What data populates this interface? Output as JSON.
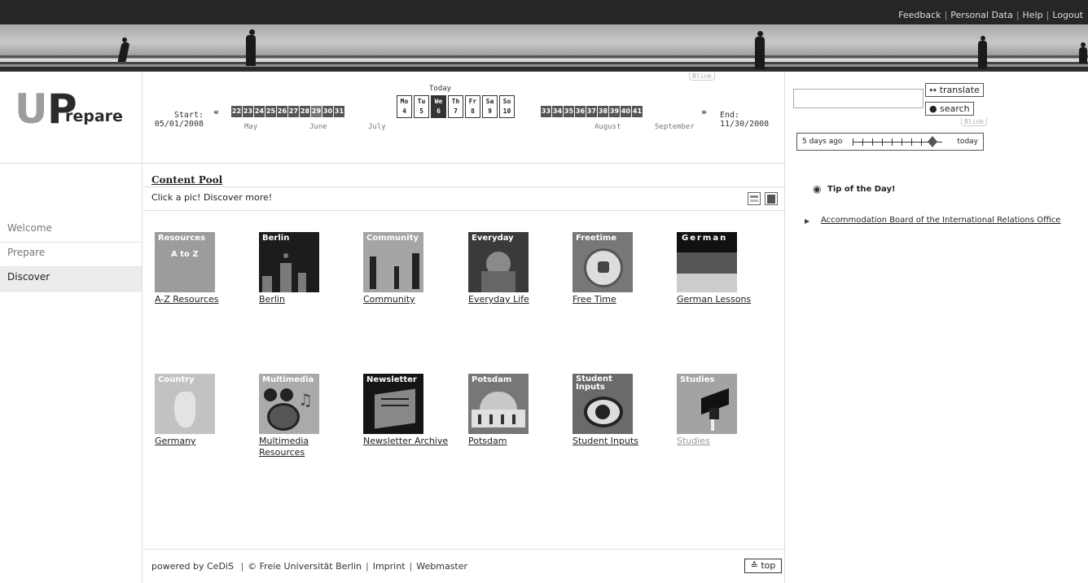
{
  "header": {
    "links": [
      "Feedback",
      "Personal Data",
      "Help",
      "Logout"
    ]
  },
  "logo": {
    "letter_u": "U",
    "letter_p": "P",
    "rest": "repare"
  },
  "timeline": {
    "start_label": "Start:",
    "start_date": "05/01/2008",
    "end_label": "End:",
    "end_date": "11/30/2008",
    "prev_arrow": "«",
    "next_arrow": "»",
    "weeks_before": [
      "22",
      "23",
      "24",
      "25",
      "26",
      "27",
      "28",
      "29",
      "30",
      "31"
    ],
    "weeks_after": [
      "33",
      "34",
      "35",
      "36",
      "37",
      "38",
      "39",
      "40",
      "41"
    ],
    "months": [
      "May",
      "June",
      "July",
      "August",
      "September"
    ],
    "today_label": "Today",
    "week_days": [
      {
        "name": "Mo",
        "num": "4"
      },
      {
        "name": "Tu",
        "num": "5"
      },
      {
        "name": "We",
        "num": "6"
      },
      {
        "name": "Th",
        "num": "7"
      },
      {
        "name": "Fr",
        "num": "8"
      },
      {
        "name": "Sa",
        "num": "9"
      },
      {
        "name": "So",
        "num": "10"
      }
    ],
    "blink_label": "Blink"
  },
  "tools": {
    "translate_label": "↔ translate",
    "search_label": "● search",
    "blink_label": "Blink",
    "slider_left": "5 days ago",
    "slider_right": "today",
    "slider_value": "today"
  },
  "nav": {
    "items": [
      "Welcome",
      "Prepare",
      "Discover"
    ],
    "active": "Discover"
  },
  "content": {
    "title": "Content Pool",
    "subtitle": "Click a pic! Discover more!",
    "tiles": [
      {
        "image_text": "Resources",
        "image_text2": "A to Z",
        "label": "A-Z Resources"
      },
      {
        "image_text": "Berlin",
        "label": "Berlin"
      },
      {
        "image_text": "Community",
        "label": "Community"
      },
      {
        "image_text": "Everyday",
        "label": "Everyday Life"
      },
      {
        "image_text": "Freetime",
        "label": "Free Time"
      },
      {
        "image_text": "German",
        "label": "German Lessons"
      },
      {
        "image_text": "Country",
        "label": "Germany"
      },
      {
        "image_text": "Multimedia",
        "label": "Multimedia",
        "label2": "Resources"
      },
      {
        "image_text": "Newsletter",
        "label": "Newsletter Archive"
      },
      {
        "image_text": "Potsdam",
        "label": "Potsdam"
      },
      {
        "image_text": "Student",
        "image_text2": "Inputs",
        "label": "Student Inputs"
      },
      {
        "image_text": "Studies",
        "label": "Studies"
      }
    ]
  },
  "tip": {
    "title": "Tip of the Day!",
    "link": "Accommodation Board of the International Relations Office"
  },
  "footer": {
    "powered": "powered by CeDiS",
    "copyright": "© Freie Universität Berlin",
    "imprint": "Imprint",
    "webmaster": "Webmaster",
    "top_label": "≙ top"
  }
}
